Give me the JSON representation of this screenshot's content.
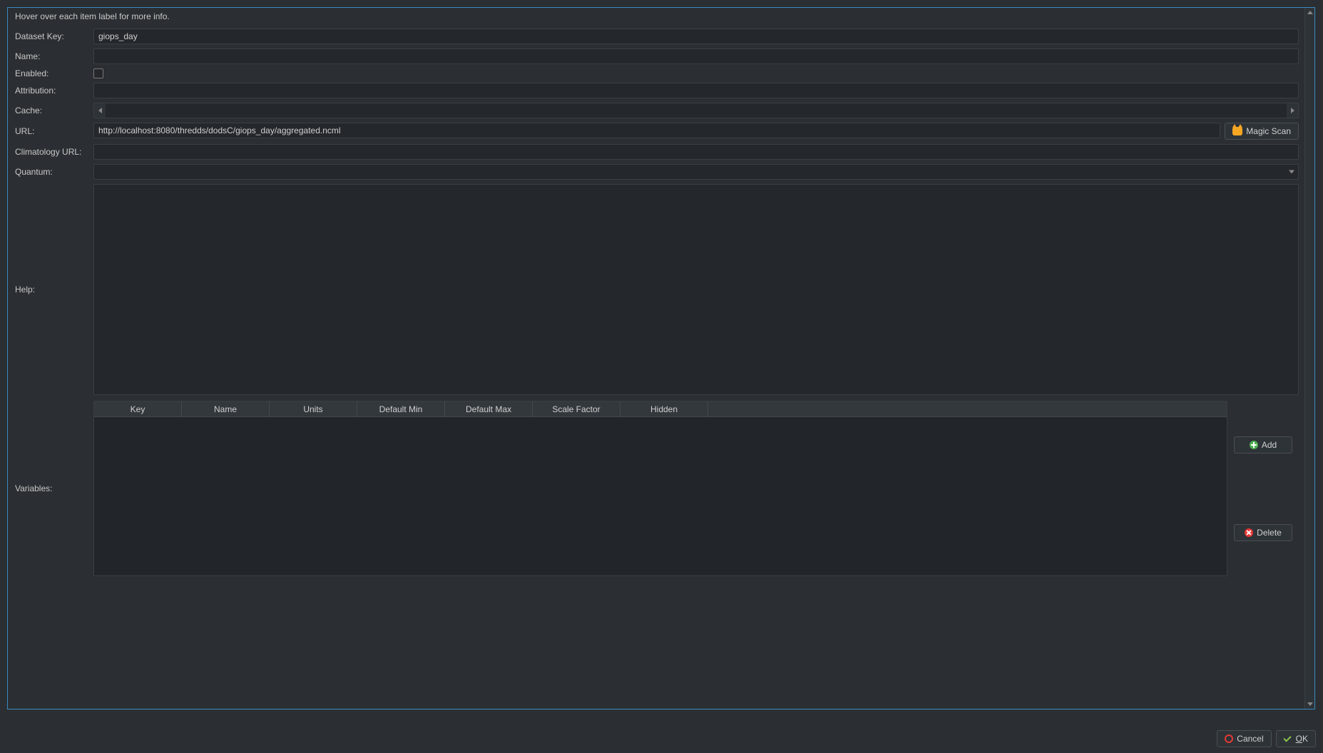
{
  "hint": "Hover over each item label for more info.",
  "labels": {
    "dataset_key": "Dataset Key:",
    "name": "Name:",
    "enabled": "Enabled:",
    "attribution": "Attribution:",
    "cache": "Cache:",
    "url": "URL:",
    "climatology_url": "Climatology URL:",
    "quantum": "Quantum:",
    "help": "Help:",
    "variables": "Variables:"
  },
  "fields": {
    "dataset_key": "giops_day",
    "name": "",
    "enabled": false,
    "attribution": "",
    "cache": "",
    "url": "http://localhost:8080/thredds/dodsC/giops_day/aggregated.ncml",
    "climatology_url": "",
    "quantum": "",
    "help": ""
  },
  "buttons": {
    "magic_scan": "Magic Scan",
    "add": "Add",
    "delete": "Delete",
    "cancel": "Cancel",
    "ok": "OK"
  },
  "variables_table": {
    "columns": [
      "Key",
      "Name",
      "Units",
      "Default Min",
      "Default Max",
      "Scale Factor",
      "Hidden"
    ],
    "rows": []
  }
}
